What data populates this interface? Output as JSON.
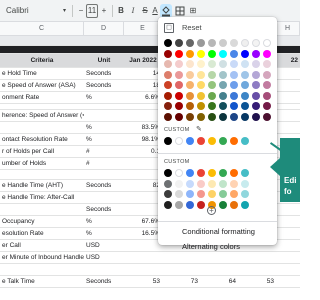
{
  "toolbar": {
    "font": "Calibri",
    "font_size": "11",
    "bold": "B",
    "italic": "I",
    "strike": "S",
    "text_color": "A"
  },
  "columns": [
    "C",
    "D",
    "E",
    "F",
    "H"
  ],
  "header": {
    "criteria": "Criteria",
    "unit": "Unit",
    "jan": "Jan 2022",
    "last": "22"
  },
  "rows": [
    {
      "criteria": "e Hold Time",
      "unit": "Seconds",
      "jan": "14",
      "feb": "",
      "mar": "",
      "apr": "",
      "last": ""
    },
    {
      "criteria": "e Speed of Answer (ASA)",
      "unit": "Seconds",
      "jan": "18",
      "feb": "",
      "mar": "",
      "apr": "",
      "last": ""
    },
    {
      "criteria": "onment Rate",
      "unit": "%",
      "jan": "6.6%",
      "feb": "",
      "mar": "",
      "apr": "",
      "last": ""
    },
    {
      "criteria": "",
      "unit": "",
      "jan": "",
      "feb": "",
      "mar": "",
      "apr": "",
      "last": ""
    },
    {
      "criteria": "herence: Speed of Answer (<",
      "unit": "",
      "jan": "",
      "feb": "",
      "mar": "",
      "apr": "",
      "last": ""
    },
    {
      "criteria": "",
      "unit": "%",
      "jan": "83.5%",
      "feb": "",
      "mar": "",
      "apr": "",
      "last": ""
    },
    {
      "criteria": "ontact Resolution Rate",
      "unit": "%",
      "jan": "98.1%",
      "feb": "",
      "mar": "",
      "apr": "",
      "last": ""
    },
    {
      "criteria": "r of Holds per Call",
      "unit": "#",
      "jan": "0.1",
      "feb": "",
      "mar": "",
      "apr": "",
      "last": ""
    },
    {
      "criteria": "umber of Holds",
      "unit": "#",
      "jan": "",
      "feb": "",
      "mar": "",
      "apr": "",
      "last": ""
    },
    {
      "criteria": "",
      "unit": "",
      "jan": "",
      "feb": "",
      "mar": "",
      "apr": "",
      "last": ""
    },
    {
      "criteria": "e Handle Time (AHT)",
      "unit": "Seconds",
      "jan": "82",
      "feb": "",
      "mar": "",
      "apr": "",
      "last": ""
    },
    {
      "criteria": "e Handle Time: After-Call",
      "unit": "",
      "jan": "",
      "feb": "",
      "mar": "",
      "apr": "",
      "last": ""
    },
    {
      "criteria": "",
      "unit": "Seconds",
      "jan": "",
      "feb": "",
      "mar": "",
      "apr": "",
      "last": ""
    },
    {
      "criteria": "Occupancy",
      "unit": "%",
      "jan": "67.6%",
      "feb": "",
      "mar": "",
      "apr": "",
      "last": ""
    },
    {
      "criteria": "esolution Rate",
      "unit": "%",
      "jan": "16.5%",
      "feb": "",
      "mar": "",
      "apr": "",
      "last": ""
    },
    {
      "criteria": "er Call",
      "unit": "USD",
      "jan": "",
      "feb": "",
      "mar": "",
      "apr": "",
      "last": ""
    },
    {
      "criteria": "er Minute of Inbound Handle",
      "unit": "USD",
      "jan": "",
      "feb": "",
      "mar": "",
      "apr": "",
      "last": ""
    },
    {
      "criteria": "",
      "unit": "",
      "jan": "",
      "feb": "",
      "mar": "",
      "apr": "",
      "last": ""
    },
    {
      "criteria": "e Talk Time",
      "unit": "Seconds",
      "jan": "53",
      "feb": "73",
      "mar": "64",
      "apr": "53",
      "last": ""
    }
  ],
  "menu": {
    "reset": "Reset",
    "custom1": "CUSTOM",
    "custom2": "CUSTOM",
    "conditional": "Conditional formatting",
    "alternating": "Alternating colors",
    "standard_colors": [
      [
        "#000000",
        "#434343",
        "#666666",
        "#999999",
        "#b7b7b7",
        "#cccccc",
        "#d9d9d9",
        "#efefef",
        "#f3f3f3",
        "#ffffff"
      ],
      [
        "#980000",
        "#ff0000",
        "#ff9900",
        "#ffff00",
        "#00ff00",
        "#00ffff",
        "#4a86e8",
        "#0000ff",
        "#9900ff",
        "#ff00ff"
      ],
      [
        "#e6b8af",
        "#f4cccc",
        "#fce5cd",
        "#fff2cc",
        "#d9ead3",
        "#d0e0e3",
        "#c9daf8",
        "#cfe2f3",
        "#d9d2e9",
        "#ead1dc"
      ],
      [
        "#dd7e6b",
        "#ea9999",
        "#f9cb9c",
        "#ffe599",
        "#b6d7a8",
        "#a2c4c9",
        "#a4c2f4",
        "#9fc5e8",
        "#b4a7d6",
        "#d5a6bd"
      ],
      [
        "#cc4125",
        "#e06666",
        "#f6b26b",
        "#ffd966",
        "#93c47d",
        "#76a5af",
        "#6d9eeb",
        "#6fa8dc",
        "#8e7cc3",
        "#c27ba0"
      ],
      [
        "#a61c00",
        "#cc0000",
        "#e69138",
        "#f1c232",
        "#6aa84f",
        "#45818e",
        "#3c78d8",
        "#3d85c6",
        "#674ea7",
        "#a64d79"
      ],
      [
        "#85200c",
        "#990000",
        "#b45f06",
        "#bf9000",
        "#38761d",
        "#134f5c",
        "#1155cc",
        "#0b5394",
        "#351c75",
        "#741b47"
      ],
      [
        "#5b0f00",
        "#660000",
        "#783f04",
        "#7f6000",
        "#274e13",
        "#0c343d",
        "#1c4587",
        "#073763",
        "#20124d",
        "#4c1130"
      ]
    ],
    "custom_colors": [
      "#000000",
      "#ffffff",
      "#4285f4",
      "#ea4335",
      "#fbbc04",
      "#34a853",
      "#ff6d01",
      "#46bdc6"
    ],
    "theme_colors": [
      [
        "#000000",
        "#ffffff",
        "#4285f4",
        "#ea4335",
        "#fbbc04",
        "#34a853",
        "#ff6d01",
        "#46bdc6"
      ],
      [
        "#6d7072",
        "#f2f2f2",
        "#c6dafc",
        "#f9cbc7",
        "#fde9b3",
        "#c0e5ca",
        "#ffd3b3",
        "#c7ebee"
      ],
      [
        "#3c3c3c",
        "#d9d9d9",
        "#8eb5fa",
        "#f4978e",
        "#fdd266",
        "#85cb98",
        "#ffa766",
        "#90d7dd"
      ],
      [
        "#1f1f1f",
        "#a6a6a6",
        "#3367d6",
        "#c5221f",
        "#f09300",
        "#188038",
        "#e8710a",
        "#12a4af"
      ]
    ]
  },
  "callout": {
    "line1": "Edi",
    "line2": "fo"
  }
}
